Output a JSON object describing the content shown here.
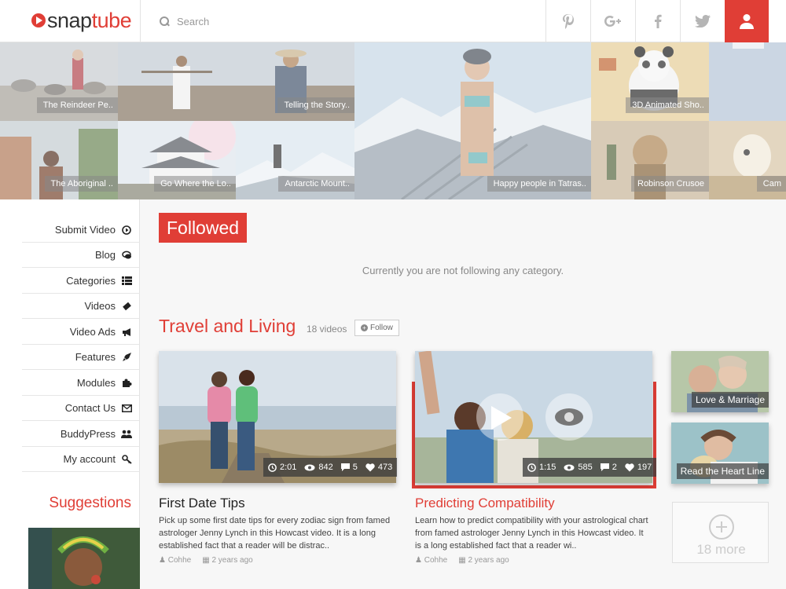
{
  "header": {
    "brand_left": "snap",
    "brand_right": "tube",
    "search_placeholder": "Search"
  },
  "hero_tiles": [
    {
      "caption": "The Reindeer Pe.."
    },
    {
      "caption": "Telling the Story.."
    },
    {
      "caption": "Happy people in Tatras.."
    },
    {
      "caption": "3D Animated Sho.."
    },
    {
      "caption": "The Aboriginal .."
    },
    {
      "caption": "Go Where the Lo.."
    },
    {
      "caption": "Antarctic Mount.."
    },
    {
      "caption": "Robinson Crusoe"
    },
    {
      "caption": "Cam"
    }
  ],
  "sidebar": {
    "items": [
      {
        "label": "Submit Video",
        "icon": "play-circle-icon"
      },
      {
        "label": "Blog",
        "icon": "comments-icon"
      },
      {
        "label": "Categories",
        "icon": "list-icon"
      },
      {
        "label": "Videos",
        "icon": "ticket-icon"
      },
      {
        "label": "Video Ads",
        "icon": "bullhorn-icon"
      },
      {
        "label": "Features",
        "icon": "rocket-icon"
      },
      {
        "label": "Modules",
        "icon": "puzzle-icon"
      },
      {
        "label": "Contact Us",
        "icon": "envelope-icon"
      },
      {
        "label": "BuddyPress",
        "icon": "users-icon"
      },
      {
        "label": "My account",
        "icon": "key-icon"
      }
    ],
    "suggestions_title": "Suggestions"
  },
  "main": {
    "followed_label": "Followed",
    "empty_message": "Currently you are not following any category.",
    "section": {
      "title": "Travel and Living",
      "count": "18 videos",
      "follow_label": "Follow"
    },
    "cards": [
      {
        "title": "First Date Tips",
        "duration": "2:01",
        "views": "842",
        "comments": "5",
        "likes": "473",
        "description": "Pick up some first date tips for every zodiac sign from famed astrologer Jenny Lynch in this Howcast video. It is a long established fact that a reader will be distrac..",
        "author": "Cohhe",
        "date": "2 years ago"
      },
      {
        "title": "Predicting Compatibility",
        "duration": "1:15",
        "views": "585",
        "comments": "2",
        "likes": "197",
        "description": "Learn how to predict compatibility with your astrological chart from famed astrologer Jenny Lynch in this Howcast video. It is a long established fact that a reader wi..",
        "author": "Cohhe",
        "date": "2 years ago"
      }
    ],
    "side_thumbs": [
      {
        "caption": "Love & Marriage"
      },
      {
        "caption": "Read the Heart Line"
      }
    ],
    "more_label": "18 more"
  },
  "colors": {
    "accent": "#e03e36",
    "text": "#333333",
    "muted": "#888888"
  }
}
